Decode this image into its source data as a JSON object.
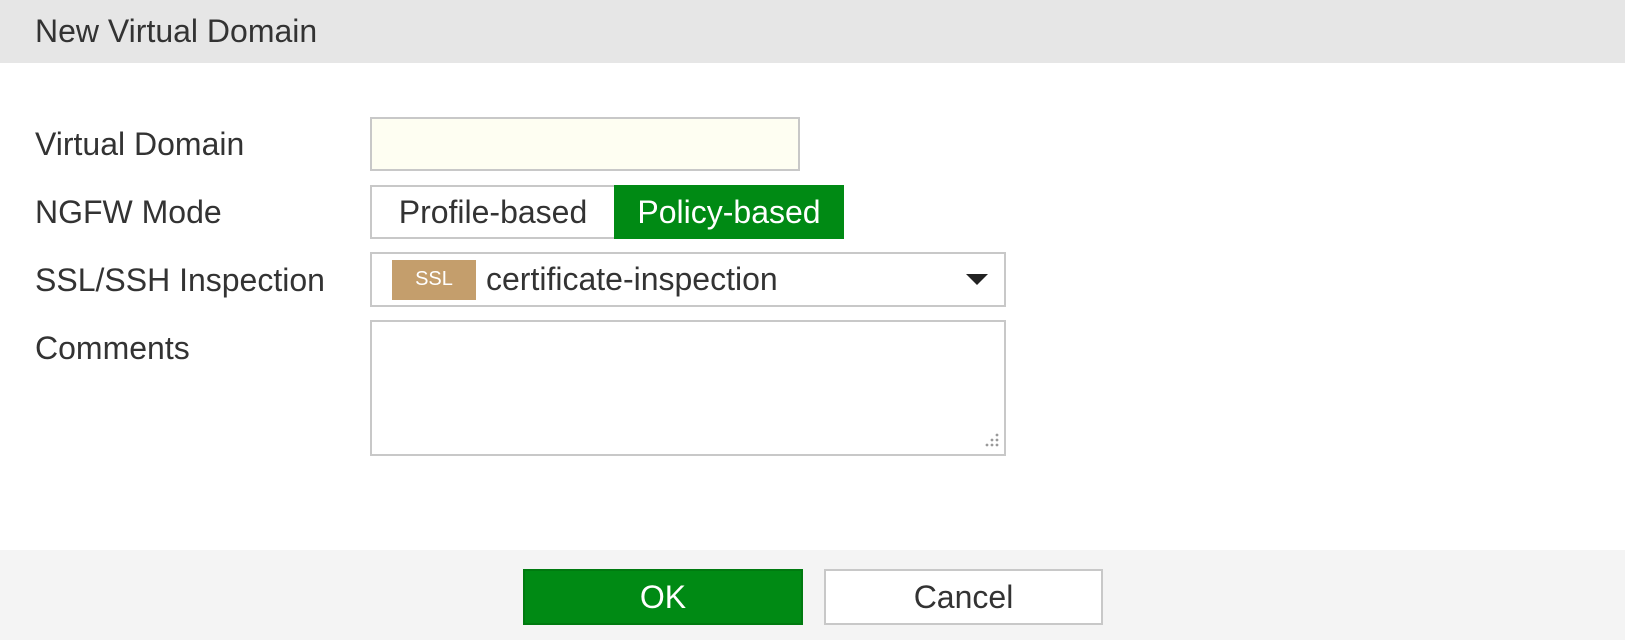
{
  "dialog": {
    "title": "New Virtual Domain"
  },
  "form": {
    "virtual_domain": {
      "label": "Virtual Domain",
      "value": "",
      "placeholder": ""
    },
    "ngfw_mode": {
      "label": "NGFW Mode",
      "options": [
        "Profile-based",
        "Policy-based"
      ],
      "selected": "Policy-based"
    },
    "ssl_inspection": {
      "label": "SSL/SSH Inspection",
      "badge": "SSL",
      "value": "certificate-inspection"
    },
    "comments": {
      "label": "Comments",
      "value": ""
    }
  },
  "footer": {
    "ok_label": "OK",
    "cancel_label": "Cancel"
  },
  "colors": {
    "accent_green": "#008a14",
    "ssl_badge": "#c49e6c",
    "input_bg": "#fefef2",
    "titlebar_bg": "#e6e6e6",
    "footer_bg": "#f4f4f4"
  },
  "icons": {
    "dropdown": "chevron-down-icon",
    "resize": "resize-grip-icon"
  }
}
